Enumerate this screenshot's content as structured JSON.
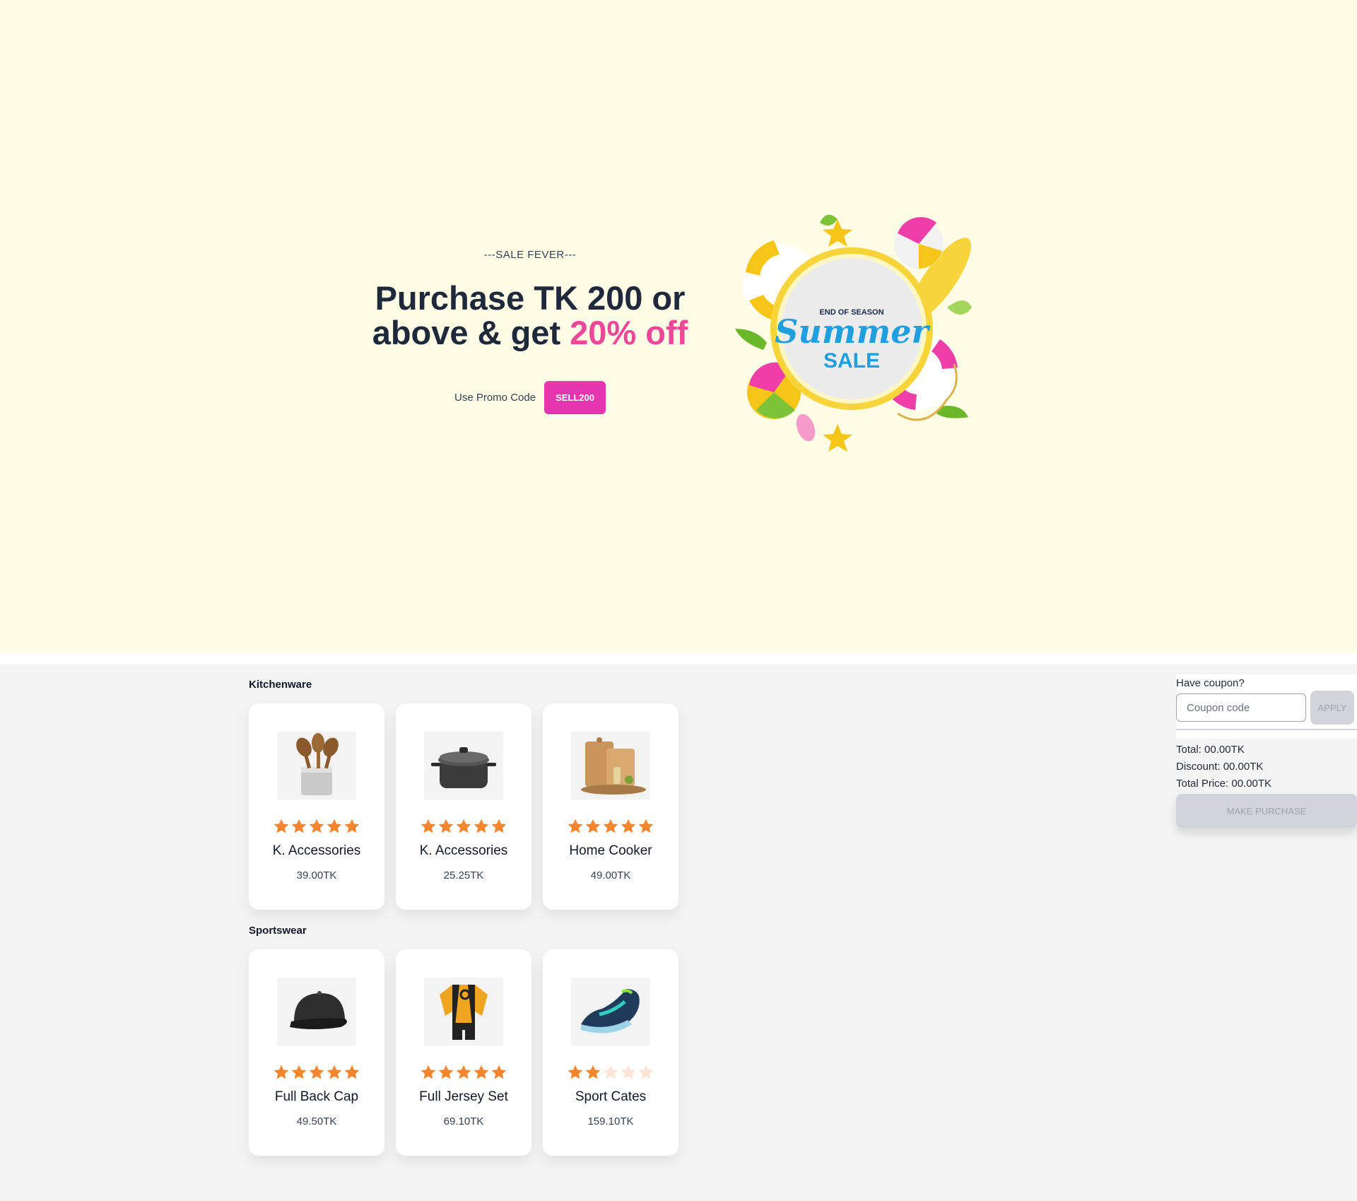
{
  "hero": {
    "eyebrow": "---SALE FEVER---",
    "headline_line1": "Purchase TK 200 or",
    "headline_line2": "above & get ",
    "headline_accent": "20% off",
    "promo_label": "Use Promo Code",
    "promo_code": "SELL200",
    "banner_text_top": "END OF SEASON",
    "banner_text_script": "Summer",
    "banner_text_bottom": "SALE"
  },
  "colors": {
    "hero_bg": "#fffde6",
    "accent_pink": "#ec4899",
    "promo_btn": "#e535b0",
    "star_filled": "#f5862e",
    "star_empty": "#fde4d6"
  },
  "categories": [
    {
      "title": "Kitchenware",
      "products": [
        {
          "name": "K. Accessories",
          "price": "39.00TK",
          "rating": 5,
          "icon": "kitchen-utensils-icon"
        },
        {
          "name": "K. Accessories",
          "price": "25.25TK",
          "rating": 5,
          "icon": "cooking-pot-icon"
        },
        {
          "name": "Home Cooker",
          "price": "49.00TK",
          "rating": 5,
          "icon": "cutting-board-icon"
        }
      ]
    },
    {
      "title": "Sportswear",
      "products": [
        {
          "name": "Full Back Cap",
          "price": "49.50TK",
          "rating": 5,
          "icon": "cap-icon"
        },
        {
          "name": "Full Jersey Set",
          "price": "69.10TK",
          "rating": 5,
          "icon": "jersey-icon"
        },
        {
          "name": "Sport Cates",
          "price": "159.10TK",
          "rating": 2,
          "icon": "sneaker-icon"
        }
      ]
    }
  ],
  "cart": {
    "coupon_label": "Have coupon?",
    "coupon_placeholder": "Coupon code",
    "apply_label": "APPLY",
    "total": "Total: 00.00TK",
    "discount": "Discount: 00.00TK",
    "total_price": "Total Price: 00.00TK",
    "purchase_label": "MAKE PURCHASE"
  }
}
